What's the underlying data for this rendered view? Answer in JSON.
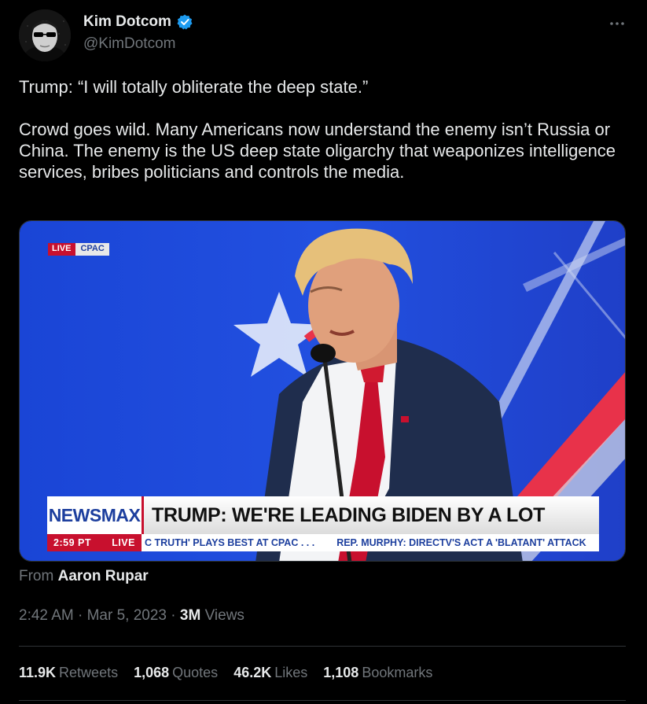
{
  "author": {
    "name": "Kim Dotcom",
    "handle": "@KimDotcom",
    "verified": true
  },
  "tweet": {
    "text": "Trump: “I will totally obliterate the deep state.”\n\nCrowd goes wild. Many Americans now understand the enemy isn’t Russia or China. The enemy is the US deep state oligarchy that weaponizes intelligence services, bribes politicians and controls the media."
  },
  "media": {
    "live_label": "LIVE",
    "event_label": "CPAC",
    "network": "NEWSMAX",
    "headline": "TRUMP: WE'RE LEADING BIDEN BY A LOT",
    "ticker_time": "2:59 PT",
    "ticker_live": "LIVE",
    "ticker_items": [
      "C TRUTH' PLAYS BEST AT CPAC . . .",
      "REP. MURPHY: DIRECTV'S ACT A 'BLATANT' ATTACK"
    ]
  },
  "attribution": {
    "prefix": "From",
    "source": "Aaron Rupar"
  },
  "meta": {
    "time": "2:42 AM",
    "sep1": "·",
    "date": "Mar 5, 2023",
    "sep2": "·",
    "views_count": "3M",
    "views_label": "Views"
  },
  "stats": {
    "retweets": {
      "count": "11.9K",
      "label": "Retweets"
    },
    "quotes": {
      "count": "1,068",
      "label": "Quotes"
    },
    "likes": {
      "count": "46.2K",
      "label": "Likes"
    },
    "bookmarks": {
      "count": "1,108",
      "label": "Bookmarks"
    }
  },
  "colors": {
    "background": "#000000",
    "text": "#e7e9ea",
    "muted": "#71767b",
    "verified": "#1d9bf0",
    "newsmax_red": "#c8102e",
    "newsmax_blue": "#1d3f9e"
  }
}
